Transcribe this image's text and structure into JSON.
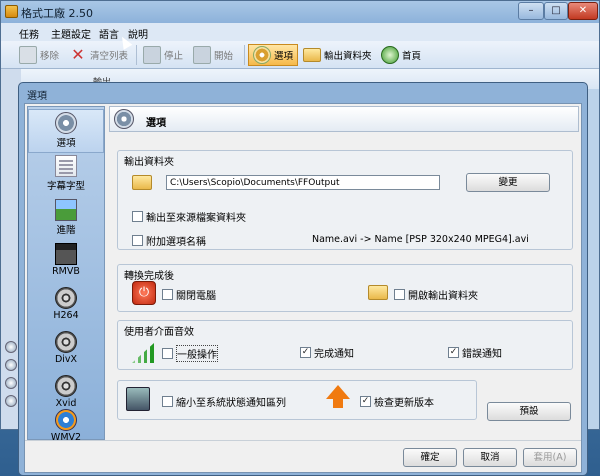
{
  "main": {
    "title": "格式工廠 2.50",
    "menu": [
      "任務",
      "主題設定",
      "語言",
      "說明"
    ],
    "toolbar": {
      "remove": "移除",
      "clear_list": "清空列表",
      "stop": "停止",
      "start": "開始",
      "options": "選項",
      "output_folder": "輸出資料夾",
      "home": "首頁"
    },
    "bg_tab": "輸出"
  },
  "dialog": {
    "title": "選項",
    "categories": [
      "選項",
      "字幕字型",
      "進階",
      "RMVB",
      "H264",
      "DivX",
      "Xvid",
      "WMV2"
    ],
    "header_title": "選項",
    "output_group": {
      "label": "輸出資料夾",
      "path": "C:\\Users\\Scopio\\Documents\\FFOutput",
      "change_button": "變更",
      "output_to_source": "輸出至來源檔案資料夾",
      "append_option_name": "附加選項名稱",
      "name_example": "Name.avi -> Name [PSP 320x240 MPEG4].avi"
    },
    "after_group": {
      "label": "轉換完成後",
      "shutdown": "關閉電腦",
      "open_folder": "開啟輸出資料夾"
    },
    "sound_group": {
      "label": "使用者介面音效",
      "general": "一般操作",
      "complete": "完成通知",
      "error": "錯誤通知"
    },
    "minimize_tray": "縮小至系統狀態通知區列",
    "check_update": "檢查更新版本",
    "default_button": "預設",
    "ok_button": "確定",
    "cancel_button": "取消",
    "apply_button": "套用(A)"
  }
}
